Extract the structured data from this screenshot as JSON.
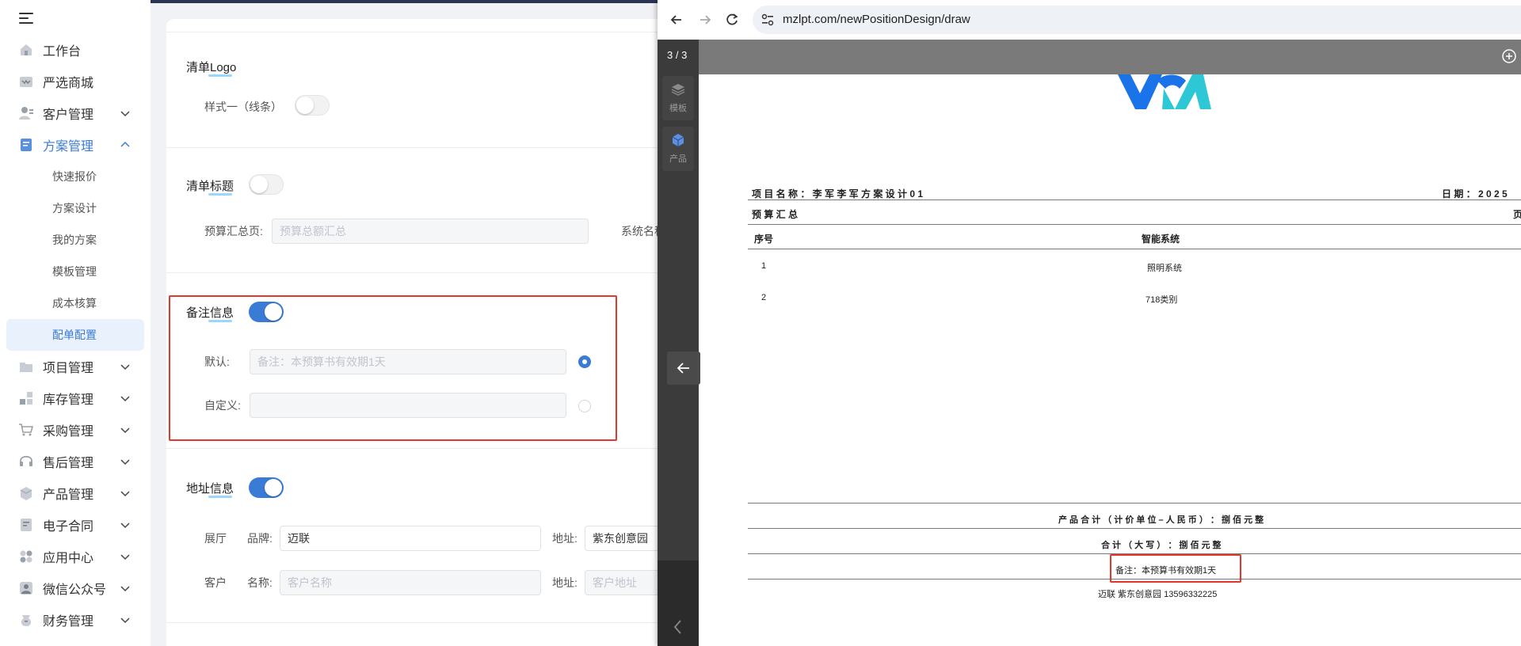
{
  "sidebar": {
    "items": [
      {
        "label": "工作台",
        "icon": "home-icon"
      },
      {
        "label": "严选商城",
        "icon": "store-icon"
      },
      {
        "label": "客户管理",
        "icon": "customer-icon"
      },
      {
        "label": "方案管理",
        "icon": "plan-icon"
      },
      {
        "label": "项目管理",
        "icon": "folder-icon"
      },
      {
        "label": "库存管理",
        "icon": "inventory-icon"
      },
      {
        "label": "采购管理",
        "icon": "cart-icon"
      },
      {
        "label": "售后管理",
        "icon": "headset-icon"
      },
      {
        "label": "产品管理",
        "icon": "box-icon"
      },
      {
        "label": "电子合同",
        "icon": "contract-icon"
      },
      {
        "label": "应用中心",
        "icon": "apps-icon"
      },
      {
        "label": "微信公众号",
        "icon": "wechat-icon"
      },
      {
        "label": "财务管理",
        "icon": "finance-icon"
      }
    ],
    "sub_items": [
      "快速报价",
      "方案设计",
      "我的方案",
      "模板管理",
      "成本核算",
      "配单配置"
    ]
  },
  "form": {
    "logo_title": "清单Logo",
    "logo_style_label": "样式一（线条）",
    "list_title_label": "清单标题",
    "budget_summary_label": "预算汇总页:",
    "budget_summary_placeholder": "预算总额汇总",
    "system_name_label": "系统名称",
    "remark_title": "备注信息",
    "default_label": "默认:",
    "default_placeholder": "备注：本预算书有效期1天",
    "custom_label": "自定义:",
    "address_title": "地址信息",
    "showroom_label": "展厅",
    "brand_label": "品牌:",
    "brand_value": "迈联",
    "address_label_1": "地址:",
    "address_value_1": "紫东创意园",
    "customer_label": "客户",
    "name_label": "名称:",
    "name_placeholder": "客户名称",
    "address_label_2": "地址:",
    "address_placeholder_2": "客户地址"
  },
  "browser": {
    "url": "mzlpt.com/newPositionDesign/draw",
    "page_counter": "3 / 3",
    "tool_template": "模板",
    "tool_product": "产品"
  },
  "doc": {
    "project_label": "项 目 名 称 ： 李 军 李 军 方 案 设 计 0 1",
    "date_label": "日 期 ： 2 0 2 5",
    "budget_summary": "预 算 汇 总",
    "page_label": "页",
    "col_no": "序号",
    "col_system": "智能系统",
    "rows": [
      {
        "no": "1",
        "system": "照明系统"
      },
      {
        "no": "2",
        "system": "718类别"
      }
    ],
    "product_total": "产 品 合 计 （ 计 价 单 位 – 人 民 币 ） ： 捌 佰 元 整",
    "total_caps": "合 计 （ 大 写 ） ： 捌 佰 元 整",
    "remark": "备注：本预算书有效期1天",
    "footer": "迈联  紫东创意园  13596332225"
  },
  "colors": {
    "accent": "#3a7bd5",
    "highlight_red": "#e5362b",
    "logo_blue": "#1a73e8",
    "logo_cyan": "#2ec7d6"
  }
}
